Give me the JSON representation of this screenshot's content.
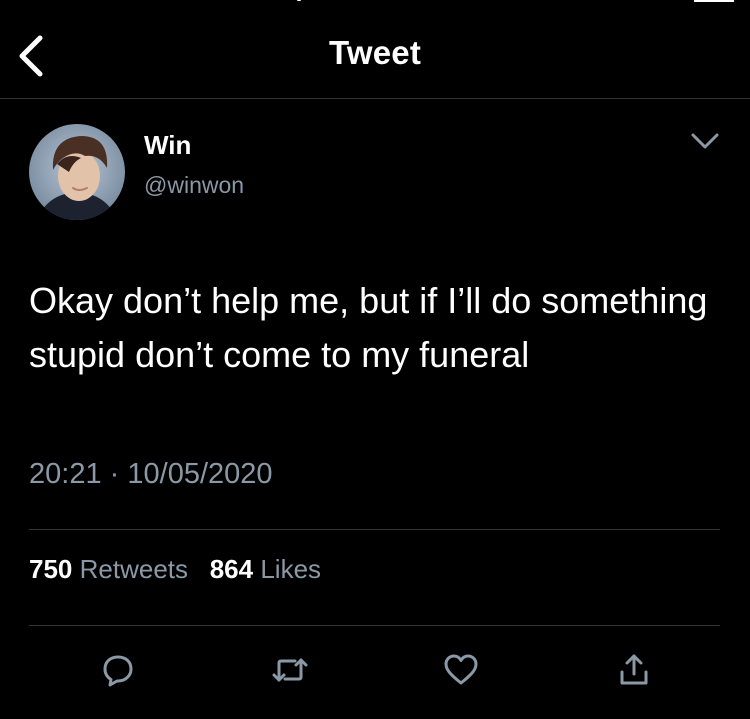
{
  "header": {
    "title": "Tweet",
    "back_icon": "chevron-left-icon"
  },
  "tweet": {
    "author": {
      "name": "Win",
      "handle": "@winwon"
    },
    "menu_icon": "chevron-down-icon",
    "text": "Okay don’t help me, but if I’ll do something stupid don’t come to my funeral",
    "time": "20:21",
    "separator": "·",
    "date": "10/05/2020",
    "stats": {
      "retweets_count": "750",
      "retweets_label": "Retweets",
      "likes_count": "864",
      "likes_label": "Likes"
    },
    "actions": [
      "reply-icon",
      "retweet-icon",
      "like-icon",
      "share-icon"
    ]
  },
  "colors": {
    "background": "#000000",
    "text": "#ffffff",
    "secondary_text": "#8b98a5",
    "divider": "#2f3336",
    "icon": "#8b98a5"
  }
}
